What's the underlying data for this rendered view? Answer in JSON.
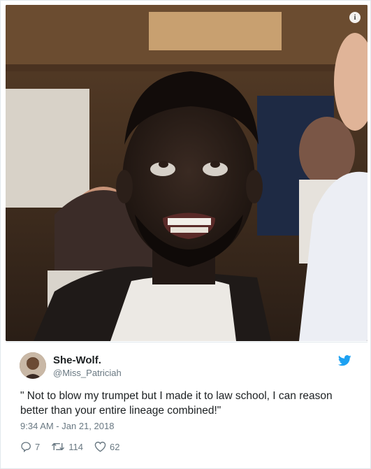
{
  "tweet": {
    "author": {
      "display_name": "She-Wolf.",
      "handle": "@Miss_Patriciah"
    },
    "text": "\" Not to blow my trumpet but I made it to law school, I can reason better than your entire lineage combined!\"",
    "timestamp": "9:34 AM - Jan 21, 2018",
    "actions": {
      "replies": "7",
      "retweets": "114",
      "likes": "62"
    },
    "media_info_glyph": "i"
  },
  "icons": {
    "info": "info-icon",
    "logo": "twitter-bird-icon",
    "reply": "reply-icon",
    "retweet": "retweet-icon",
    "like": "heart-icon"
  },
  "colors": {
    "brand": "#1da1f2",
    "text": "#1c2022",
    "secondary": "#697882",
    "border": "#e1e8ed"
  }
}
